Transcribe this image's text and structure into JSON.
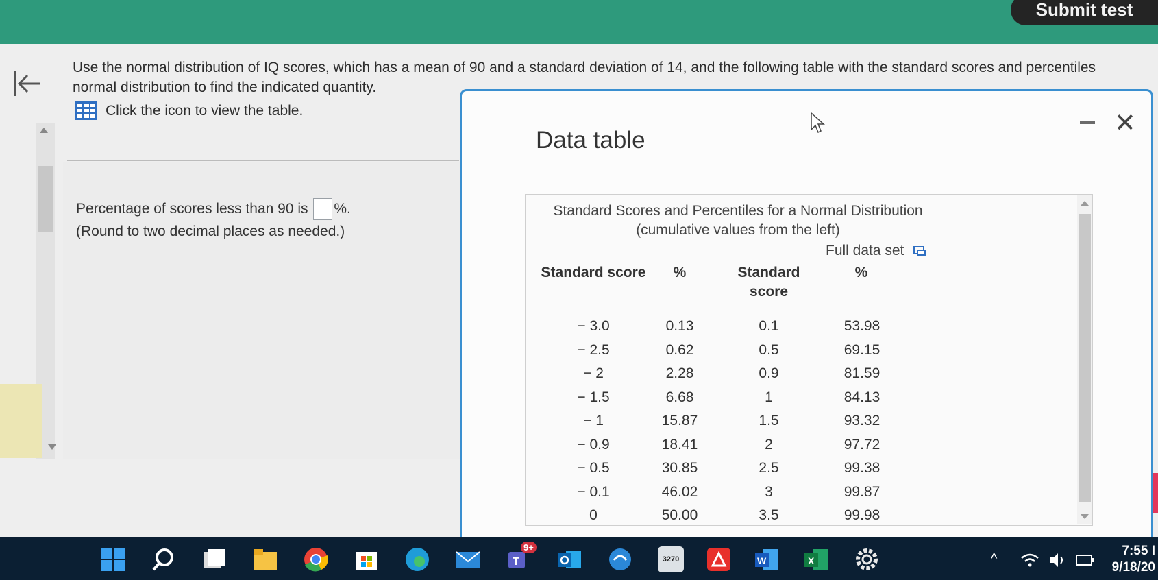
{
  "header": {
    "submit_label": "Submit test"
  },
  "prompt": {
    "line1": "Use the normal distribution of IQ scores, which has a mean of 90 and a standard deviation of 14, and the following table with the standard scores and percentiles",
    "line2": "normal distribution to find the indicated quantity.",
    "table_link": "Click the icon to view the table."
  },
  "question": {
    "before": "Percentage of scores less than 90 is",
    "after": "%.",
    "hint": "(Round to two decimal places as needed.)",
    "answer_value": ""
  },
  "dialog": {
    "title": "Data table",
    "table_title_line1": "Standard Scores and Percentiles for a Normal Distribution",
    "table_title_line2": "(cumulative values from the left)",
    "full_data_label": "Full data set",
    "headers": {
      "score1": "Standard score",
      "pct1": "%",
      "score2_a": "Standard",
      "score2_b": "score",
      "pct2": "%"
    },
    "left_scores": [
      "− 3.0",
      "− 2.5",
      "− 2",
      "− 1.5",
      "− 1",
      "− 0.9",
      "− 0.5",
      "− 0.1",
      "0"
    ],
    "left_pcts": [
      "0.13",
      "0.62",
      "2.28",
      "6.68",
      "15.87",
      "18.41",
      "30.85",
      "46.02",
      "50.00"
    ],
    "right_scores": [
      "0.1",
      "0.5",
      "0.9",
      "1",
      "1.5",
      "2",
      "2.5",
      "3",
      "3.5"
    ],
    "right_pcts": [
      "53.98",
      "69.15",
      "81.59",
      "84.13",
      "93.32",
      "97.72",
      "99.38",
      "99.87",
      "99.98"
    ]
  },
  "taskbar": {
    "teams_badge": "9+",
    "terminal_label": "3270",
    "time": "7:55 I",
    "date": "9/18/20"
  },
  "icons": {
    "back": "back-arrow-icon",
    "grid": "table-grid-icon",
    "close": "close-icon",
    "minimize": "minimize-icon",
    "popout": "popout-icon"
  },
  "colors": {
    "topbar": "#2e9a7c",
    "dialog_border": "#3a8fd0",
    "taskbar": "#0b1f33"
  }
}
